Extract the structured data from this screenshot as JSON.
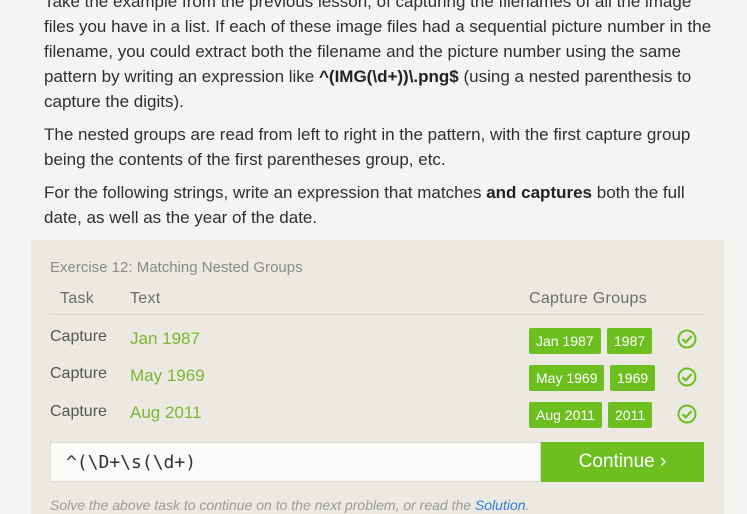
{
  "lesson": {
    "p1_a": "Take the example from the previous lesson, of capturing the filenames of all the image files you have in a list. If each of these image files had a sequential picture number in the filename, you could extract both the filename and the picture number using the same pattern by writing an expression like ",
    "p1_code": "^(IMG(\\d+))\\.png$",
    "p1_b": " (using a nested parenthesis to capture the digits).",
    "p2": "The nested groups are read from left to right in the pattern, with the first capture group being the contents of the first parentheses group, etc.",
    "p3_a": "For the following strings, write an expression that matches ",
    "p3_b": "and captures",
    "p3_c": " both the full date, as well as the year of the date."
  },
  "exercise": {
    "title": "Exercise 12: Matching Nested Groups",
    "col_task": "Task",
    "col_text": "Text",
    "col_groups": "Capture Groups",
    "rows": [
      {
        "task": "Capture",
        "text": "Jan 1987",
        "g1": "Jan 1987",
        "g2": "1987"
      },
      {
        "task": "Capture",
        "text": "May 1969",
        "g1": "May 1969",
        "g2": "1969"
      },
      {
        "task": "Capture",
        "text": "Aug 2011",
        "g1": "Aug 2011",
        "g2": "2011"
      }
    ],
    "input_value": "^(\\D+\\s(\\d+)",
    "continue_label": "Continue ›",
    "hint_a": "Solve the above task to continue on to the next problem, or read the ",
    "hint_link": "Solution",
    "hint_b": "."
  },
  "colors": {
    "accent": "#6cbf1f",
    "text_green": "#7cb82f",
    "link": "#2a7fd4"
  }
}
